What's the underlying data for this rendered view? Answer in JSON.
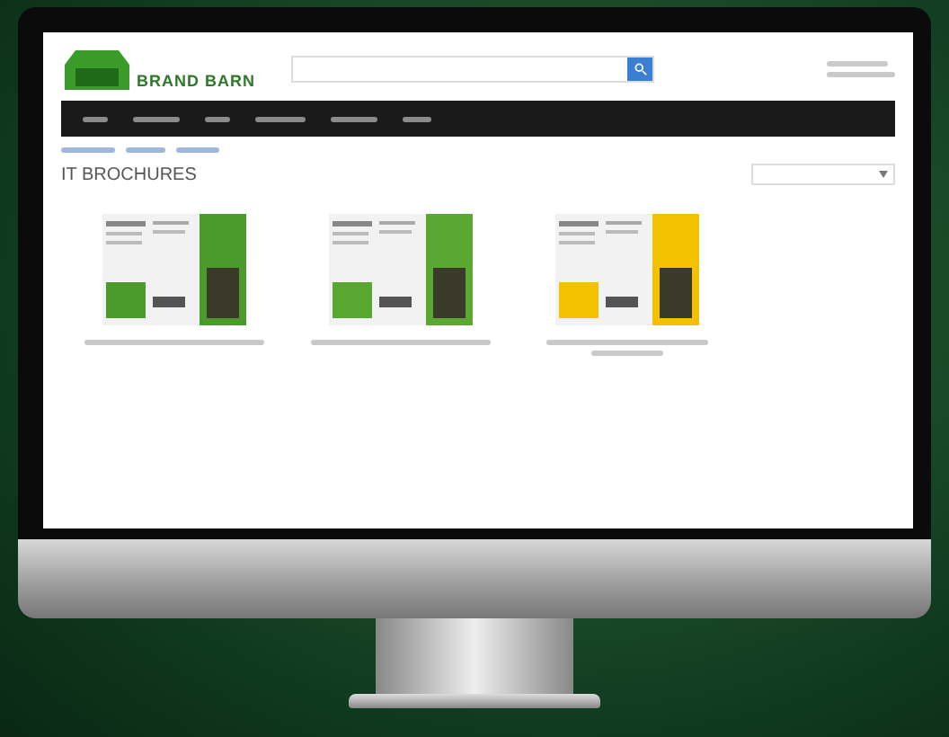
{
  "logo": {
    "text": "BRAND BARN"
  },
  "page": {
    "heading": "IT BROCHURES"
  },
  "brochures": [
    {
      "color": "#4a9a2c"
    },
    {
      "color": "#5aa832"
    },
    {
      "color": "#f2c200"
    }
  ]
}
